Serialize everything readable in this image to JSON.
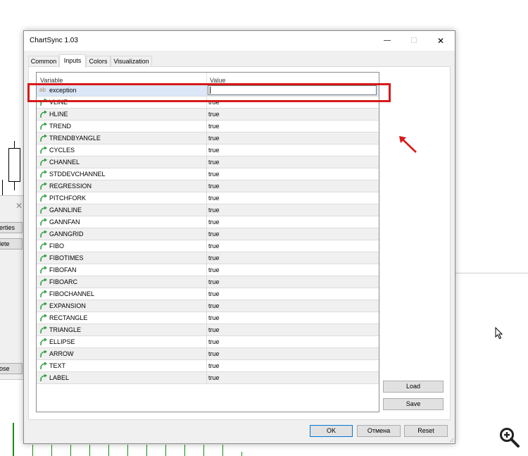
{
  "window": {
    "title": "ChartSync 1.03",
    "minimize_glyph": "—",
    "maximize_glyph": "☐",
    "close_glyph": "✕"
  },
  "tabs": [
    {
      "label": "Common",
      "active": false
    },
    {
      "label": "Inputs",
      "active": true
    },
    {
      "label": "Colors",
      "active": false
    },
    {
      "label": "Visualization",
      "active": false
    }
  ],
  "grid": {
    "col_variable": "Variable",
    "col_value": "Value",
    "rows": [
      {
        "icon": "ab-text-icon",
        "icon_glyph": "ab",
        "name": "exception",
        "value": ""
      },
      {
        "icon": "bool-arrow-icon",
        "icon_glyph": "",
        "name": "VLINE",
        "value": "true"
      },
      {
        "icon": "bool-arrow-icon",
        "icon_glyph": "",
        "name": "HLINE",
        "value": "true"
      },
      {
        "icon": "bool-arrow-icon",
        "icon_glyph": "",
        "name": "TREND",
        "value": "true"
      },
      {
        "icon": "bool-arrow-icon",
        "icon_glyph": "",
        "name": "TRENDBYANGLE",
        "value": "true"
      },
      {
        "icon": "bool-arrow-icon",
        "icon_glyph": "",
        "name": "CYCLES",
        "value": "true"
      },
      {
        "icon": "bool-arrow-icon",
        "icon_glyph": "",
        "name": "CHANNEL",
        "value": "true"
      },
      {
        "icon": "bool-arrow-icon",
        "icon_glyph": "",
        "name": "STDDEVCHANNEL",
        "value": "true"
      },
      {
        "icon": "bool-arrow-icon",
        "icon_glyph": "",
        "name": "REGRESSION",
        "value": "true"
      },
      {
        "icon": "bool-arrow-icon",
        "icon_glyph": "",
        "name": "PITCHFORK",
        "value": "true"
      },
      {
        "icon": "bool-arrow-icon",
        "icon_glyph": "",
        "name": "GANNLINE",
        "value": "true"
      },
      {
        "icon": "bool-arrow-icon",
        "icon_glyph": "",
        "name": "GANNFAN",
        "value": "true"
      },
      {
        "icon": "bool-arrow-icon",
        "icon_glyph": "",
        "name": "GANNGRID",
        "value": "true"
      },
      {
        "icon": "bool-arrow-icon",
        "icon_glyph": "",
        "name": "FIBO",
        "value": "true"
      },
      {
        "icon": "bool-arrow-icon",
        "icon_glyph": "",
        "name": "FIBOTIMES",
        "value": "true"
      },
      {
        "icon": "bool-arrow-icon",
        "icon_glyph": "",
        "name": "FIBOFAN",
        "value": "true"
      },
      {
        "icon": "bool-arrow-icon",
        "icon_glyph": "",
        "name": "FIBOARC",
        "value": "true"
      },
      {
        "icon": "bool-arrow-icon",
        "icon_glyph": "",
        "name": "FIBOCHANNEL",
        "value": "true"
      },
      {
        "icon": "bool-arrow-icon",
        "icon_glyph": "",
        "name": "EXPANSION",
        "value": "true"
      },
      {
        "icon": "bool-arrow-icon",
        "icon_glyph": "",
        "name": "RECTANGLE",
        "value": "true"
      },
      {
        "icon": "bool-arrow-icon",
        "icon_glyph": "",
        "name": "TRIANGLE",
        "value": "true"
      },
      {
        "icon": "bool-arrow-icon",
        "icon_glyph": "",
        "name": "ELLIPSE",
        "value": "true"
      },
      {
        "icon": "bool-arrow-icon",
        "icon_glyph": "",
        "name": "ARROW",
        "value": "true"
      },
      {
        "icon": "bool-arrow-icon",
        "icon_glyph": "",
        "name": "TEXT",
        "value": "true"
      },
      {
        "icon": "bool-arrow-icon",
        "icon_glyph": "",
        "name": "LABEL",
        "value": "true"
      }
    ]
  },
  "side_buttons": {
    "load": "Load",
    "save": "Save"
  },
  "footer": {
    "ok": "OK",
    "cancel": "Отмена",
    "reset": "Reset"
  },
  "background_panel": {
    "close_glyph": "✕",
    "buttons": [
      "erties",
      "lete",
      "ose"
    ]
  },
  "colors": {
    "highlight": "#d61a1a",
    "annotation_arrow": "#d61a1a",
    "bool_icon": "#2e9e3e",
    "selected_row": "#dbe7f7",
    "default_button_border": "#0078d7"
  }
}
